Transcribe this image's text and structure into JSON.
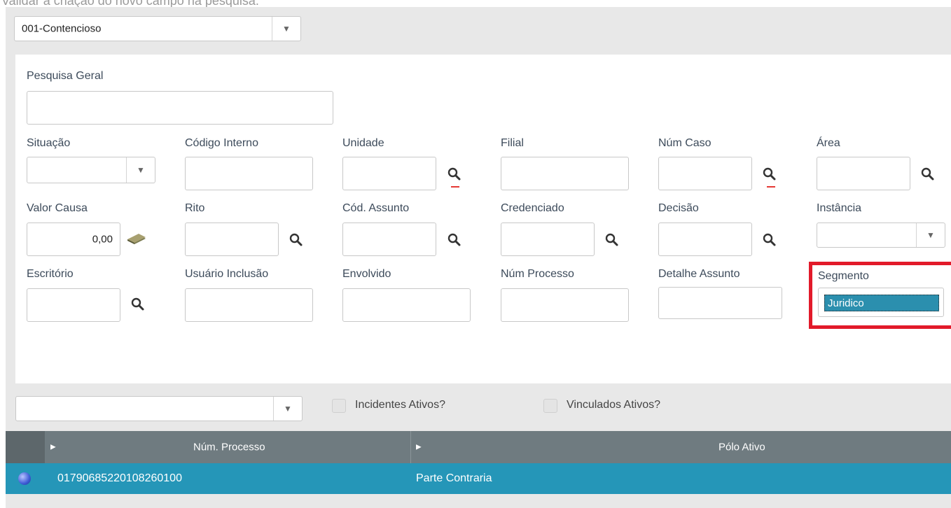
{
  "caption": "Validar a criação do novo campo na pesquisa.",
  "top_select": {
    "value": "001-Contencioso"
  },
  "form": {
    "pesquisa_geral_label": "Pesquisa Geral",
    "situacao_label": "Situação",
    "codigo_interno_label": "Código Interno",
    "unidade_label": "Unidade",
    "filial_label": "Filial",
    "num_caso_label": "Núm Caso",
    "area_label": "Área",
    "valor_causa_label": "Valor Causa",
    "valor_causa_value": "0,00",
    "rito_label": "Rito",
    "cod_assunto_label": "Cód. Assunto",
    "credenciado_label": "Credenciado",
    "decisao_label": "Decisão",
    "instancia_label": "Instância",
    "escritorio_label": "Escritório",
    "usuario_inclusao_label": "Usuário Inclusão",
    "envolvido_label": "Envolvido",
    "num_processo_label": "Núm Processo",
    "detalhe_assunto_label": "Detalhe Assunto",
    "segmento_label": "Segmento",
    "segmento_value": "Juridico"
  },
  "filter_bar": {
    "select_value": "",
    "incidentes_label": "Incidentes Ativos?",
    "vinculados_label": "Vinculados Ativos?"
  },
  "grid": {
    "columns": [
      "Núm. Processo",
      "Pólo Ativo"
    ],
    "rows": [
      {
        "num_processo": "01790685220108260100",
        "polo_ativo": "Parte Contraria"
      }
    ]
  },
  "colors": {
    "highlight_border": "#e21a2a",
    "grid_header": "#6f7b80",
    "selected_row": "#2596b8",
    "label_text": "#3c4a5a"
  },
  "icons": [
    "search-icon",
    "money-icon",
    "chevron-down-icon",
    "caret-right-icon",
    "status-dot-icon"
  ]
}
